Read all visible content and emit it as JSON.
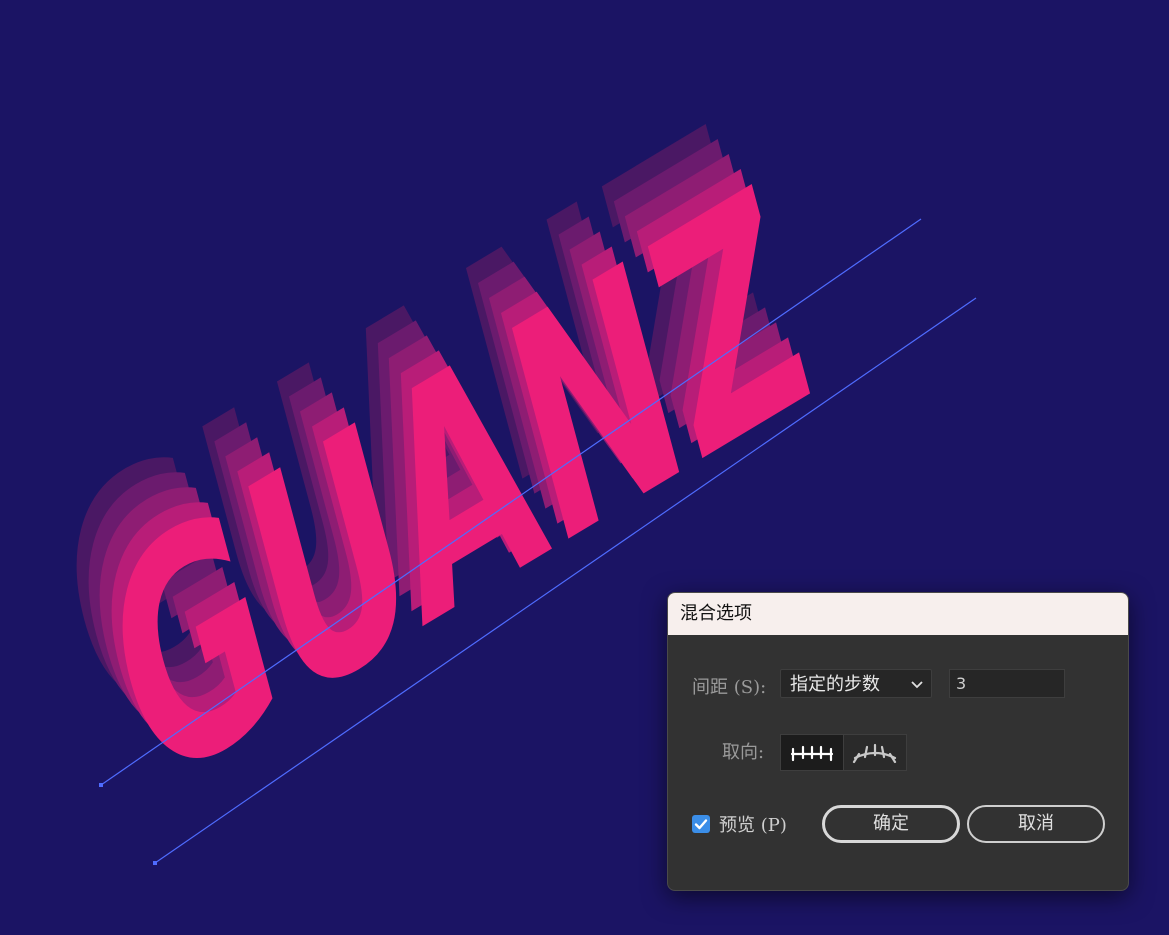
{
  "canvas": {
    "background": "#1b1464",
    "artwork_text": "GUANZ",
    "blend_colors": [
      "#4a1864",
      "#6b1b6e",
      "#8e1d73",
      "#b81d78",
      "#ec1e79"
    ],
    "path_color": "#4f6cff"
  },
  "dialog": {
    "title": "混合选项",
    "spacing_label": "间距 (S):",
    "spacing_option": "指定的步数",
    "steps_value": "3",
    "orientation_label": "取向:",
    "orientation_options": [
      "align-to-page-icon",
      "align-to-path-icon"
    ],
    "preview_label": "预览 (P)",
    "preview_checked": true,
    "ok_label": "确定",
    "cancel_label": "取消",
    "accent_color": "#3b8ee8"
  }
}
